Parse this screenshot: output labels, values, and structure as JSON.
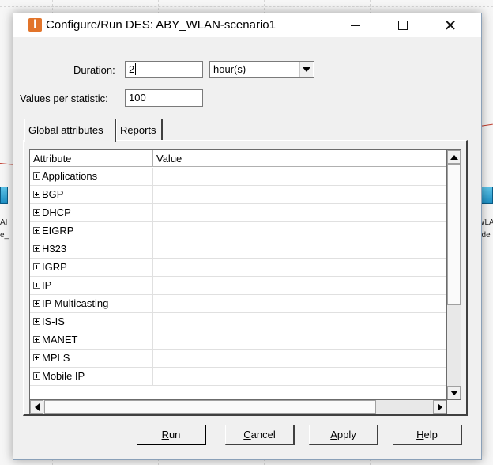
{
  "window": {
    "title": "Configure/Run DES: ABY_WLAN-scenario1",
    "app_icon_glyph": "I"
  },
  "form": {
    "duration_label": "Duration:",
    "duration_value": "2",
    "duration_unit": "hour(s)",
    "values_label": "Values per statistic:",
    "values_value": "100"
  },
  "tabs": [
    {
      "label": "Global attributes",
      "active": true
    },
    {
      "label": "Reports",
      "active": false
    }
  ],
  "grid": {
    "columns": [
      "Attribute",
      "Value"
    ],
    "rows": [
      {
        "attribute": "Applications",
        "value": ""
      },
      {
        "attribute": "BGP",
        "value": ""
      },
      {
        "attribute": "DHCP",
        "value": ""
      },
      {
        "attribute": "EIGRP",
        "value": ""
      },
      {
        "attribute": "H323",
        "value": ""
      },
      {
        "attribute": "IGRP",
        "value": ""
      },
      {
        "attribute": "IP",
        "value": ""
      },
      {
        "attribute": "IP Multicasting",
        "value": ""
      },
      {
        "attribute": "IS-IS",
        "value": ""
      },
      {
        "attribute": "MANET",
        "value": ""
      },
      {
        "attribute": "MPLS",
        "value": ""
      },
      {
        "attribute": "Mobile IP",
        "value": ""
      }
    ]
  },
  "buttons": {
    "run_first": "R",
    "run_rest": "un",
    "cancel_first": "C",
    "cancel_rest": "ancel",
    "apply_first": "A",
    "apply_rest": "pply",
    "help_first": "H",
    "help_rest": "elp"
  },
  "background": {
    "left_node_labels": [
      "AI",
      "e_"
    ],
    "right_node_labels": [
      "WLA",
      "ode"
    ]
  },
  "colors": {
    "app_icon": "#e2742a",
    "node": "#1d8fc4",
    "link_line": "#c0392b"
  }
}
